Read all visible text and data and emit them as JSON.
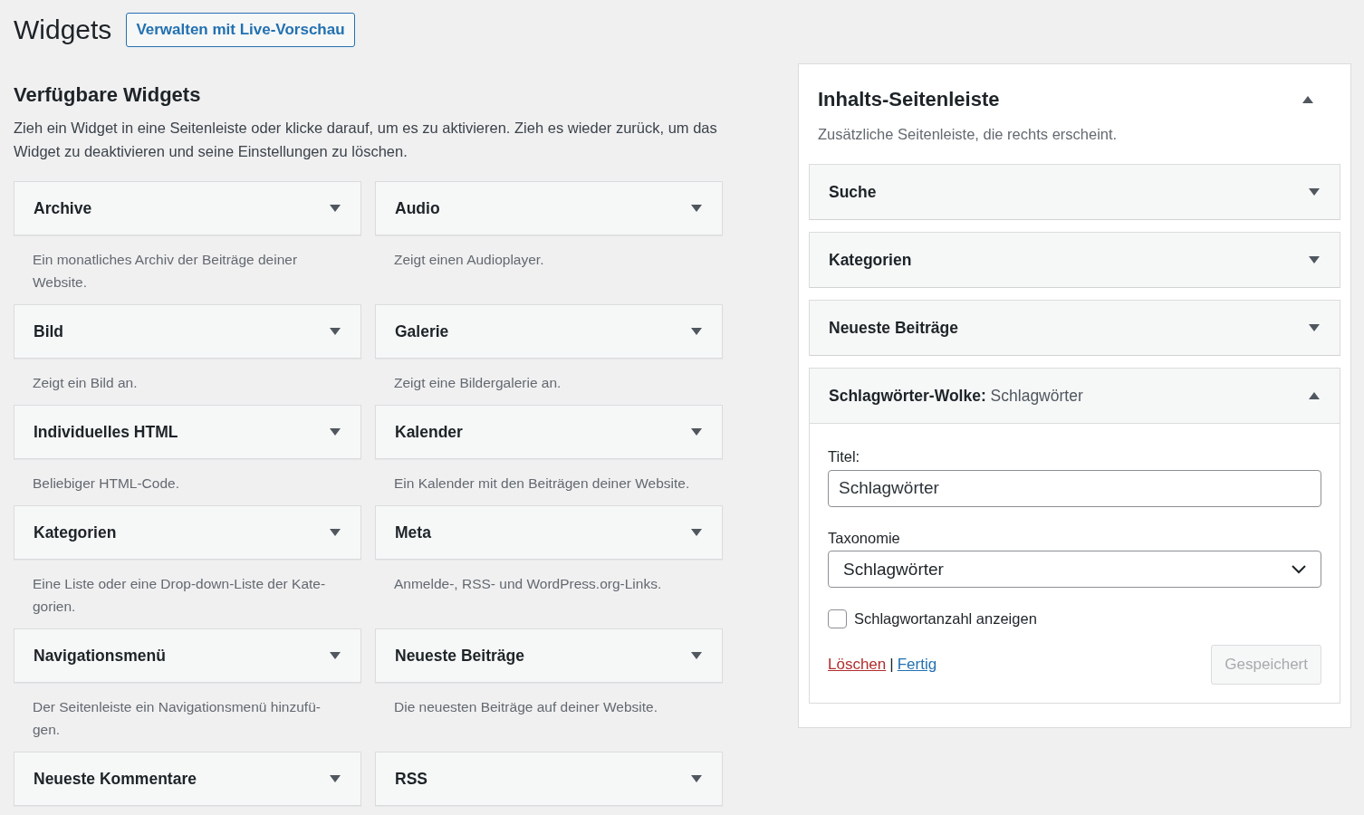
{
  "title": "Widgets",
  "header_button": "Verwalten mit Live-Vorschau",
  "available": {
    "heading": "Verfügbare Widgets",
    "description": "Zieh ein Widget in eine Seitenleiste oder klicke darauf, um es zu aktivieren. Zieh es wieder zurück, um das Widget zu deaktivieren und seine Einstellungen zu löschen.",
    "widgets": [
      {
        "name": "Archive",
        "description": "Ein monatliches Archiv der Beiträge deiner Website."
      },
      {
        "name": "Audio",
        "description": "Zeigt einen Audioplayer."
      },
      {
        "name": "Bild",
        "description": "Zeigt ein Bild an."
      },
      {
        "name": "Galerie",
        "description": "Zeigt eine Bildergalerie an."
      },
      {
        "name": "Individuelles HTML",
        "description": "Beliebiger HTML-Code."
      },
      {
        "name": "Kalender",
        "description": "Ein Kalender mit den Beiträgen deiner Website."
      },
      {
        "name": "Kategorien",
        "description": "Eine Liste oder eine Drop-down-Liste der Kate-gorien."
      },
      {
        "name": "Meta",
        "description": "Anmelde-, RSS- und WordPress.org-Links."
      },
      {
        "name": "Navigationsmenü",
        "description": "Der Seitenleiste ein Navigationsmenü hinzufü-gen."
      },
      {
        "name": "Neueste Beiträge",
        "description": "Die neuesten Beiträge auf deiner Website."
      },
      {
        "name": "Neueste Kommentare"
      },
      {
        "name": "RSS"
      }
    ]
  },
  "sidebar": {
    "title": "Inhalts-Seitenleiste",
    "expanded": true,
    "description": "Zusätzliche Seitenleiste, die rechts erscheint.",
    "widgets": [
      {
        "name": "Suche",
        "expanded": false
      },
      {
        "name": "Kategorien",
        "expanded": false
      },
      {
        "name": "Neueste Beiträge",
        "expanded": false
      },
      {
        "name": "Schlagwörter-Wolke",
        "name_suffix": ":",
        "instance_title": "Schlagwörter",
        "expanded": true,
        "fields": [
          {
            "kind": "text",
            "label": "Titel:",
            "value": "Schlagwörter"
          },
          {
            "kind": "select",
            "label": "Taxonomie",
            "value": "Schlagwörter"
          },
          {
            "kind": "checkbox",
            "label": "Schlagwortanzahl anzeigen",
            "checked": false
          }
        ],
        "delete_link": "Löschen",
        "separator": "|",
        "done_link": "Fertig",
        "save_button": {
          "label": "Gespeichert",
          "disabled": true
        }
      }
    ]
  }
}
